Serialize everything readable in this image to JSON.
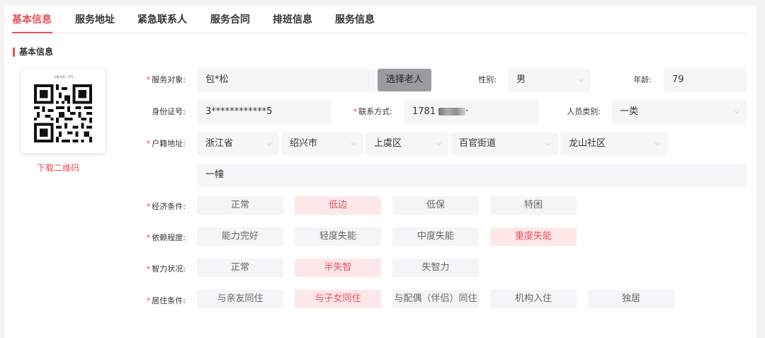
{
  "tabs": [
    "基本信息",
    "服务地址",
    "紧急联系人",
    "服务合同",
    "排班信息",
    "服务信息"
  ],
  "section_title": "基本信息",
  "qr": {
    "caption": "注册号码：155",
    "download_label": "下载二维码"
  },
  "form": {
    "service_target": {
      "label": "服务对象:",
      "value": "包*松",
      "button": "选择老人"
    },
    "gender": {
      "label": "性别:",
      "value": "男"
    },
    "age": {
      "label": "年龄:",
      "value": "79"
    },
    "id_number": {
      "label": "身份证号:",
      "value": "3************5"
    },
    "contact": {
      "label": "联系方式:",
      "value": "1781",
      "value_suffix": "·"
    },
    "person_type": {
      "label": "人员类别:",
      "value": "一类"
    },
    "household": {
      "label": "户籍地址:",
      "province": "浙江省",
      "city": "绍兴市",
      "district": "上虞区",
      "street": "百官街道",
      "community": "龙山社区",
      "detail": "一幢"
    },
    "economy": {
      "label": "经济条件:",
      "options": [
        "正常",
        "低边",
        "低保",
        "特困"
      ],
      "selected": "低边"
    },
    "dependency": {
      "label": "依赖程度:",
      "options": [
        "能力完好",
        "轻度失能",
        "中度失能",
        "重度失能"
      ],
      "selected": "重度失能"
    },
    "intellect": {
      "label": "智力状况:",
      "options": [
        "正常",
        "半失智",
        "失智力"
      ],
      "selected": "半失智"
    },
    "living": {
      "label": "居住条件:",
      "options": [
        "与亲友同住",
        "与子女同住",
        "与配偶（伴侣）同住",
        "机构入住",
        "独居"
      ],
      "selected": "与子女同住"
    }
  },
  "colors": {
    "accent": "#e8505b",
    "field_bg": "#f5f6f7",
    "chip_selected_bg": "#fde7e9"
  }
}
